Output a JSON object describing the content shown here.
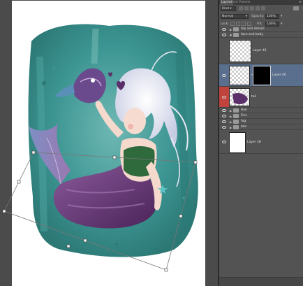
{
  "panel_tabs": [
    {
      "label": "Layers",
      "active": true
    },
    {
      "label": "Font Presets",
      "active": false
    }
  ],
  "filter": {
    "kind_label": "Kind"
  },
  "blend_mode": "Normal",
  "opacity": {
    "label": "Opacity:",
    "value": "100%"
  },
  "lock": {
    "label": "Lock:"
  },
  "fill": {
    "label": "Fill:",
    "value": "100%"
  },
  "layers": [
    {
      "type": "group",
      "name": "top and details",
      "visible": true
    },
    {
      "type": "group",
      "name": "face and body",
      "visible": true
    },
    {
      "type": "layer",
      "name": "Layer 41",
      "visible": false
    },
    {
      "type": "layer",
      "name": "Layer 40",
      "visible": true,
      "selected": true,
      "has_mask": true
    },
    {
      "type": "layer",
      "name": "tail",
      "visible": true,
      "color_tag": "#c0433d"
    },
    {
      "type": "group",
      "name": "Hair",
      "visible": true
    },
    {
      "type": "group",
      "name": "Fins",
      "visible": true
    },
    {
      "type": "group",
      "name": "fog",
      "visible": true
    },
    {
      "type": "group",
      "name": "bits",
      "visible": true
    },
    {
      "type": "layer",
      "name": "Layer 18",
      "visible": true
    }
  ],
  "colors": {
    "panel_bg": "#535353",
    "selected_layer": "#5a6f8e",
    "workspace_bg": "#4b4b4b",
    "teal": "#2f8a88",
    "purple_tail": "#5a2f6a"
  }
}
